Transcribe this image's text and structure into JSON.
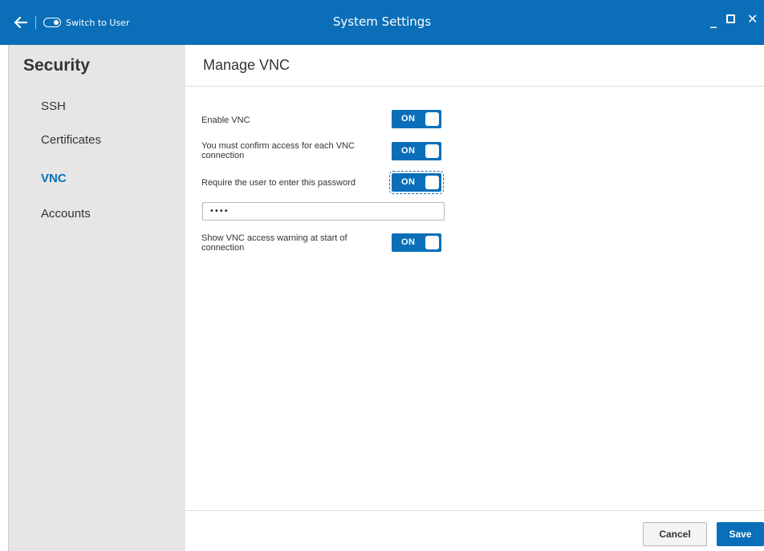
{
  "titlebar": {
    "title": "System Settings",
    "switch_user_label": "Switch to User",
    "minimize_label": "_",
    "close_label": "✕"
  },
  "sidebar": {
    "title": "Security",
    "items": [
      {
        "label": "SSH",
        "active": false
      },
      {
        "label": "Certificates",
        "active": false
      },
      {
        "label": "VNC",
        "active": true
      },
      {
        "label": "Accounts",
        "active": false
      }
    ]
  },
  "main": {
    "title": "Manage VNC",
    "options": [
      {
        "label": "Enable VNC",
        "state": "ON"
      },
      {
        "label": "You must confirm access for each VNC connection",
        "state": "ON"
      },
      {
        "label": "Require the user to enter this password",
        "state": "ON"
      },
      {
        "label": "Show VNC access warning at start of connection",
        "state": "ON"
      }
    ],
    "password_value": "••••"
  },
  "footer": {
    "cancel_label": "Cancel",
    "save_label": "Save"
  },
  "colors": {
    "accent": "#0a6fb8",
    "sidebar_bg": "#e6e6e6"
  }
}
